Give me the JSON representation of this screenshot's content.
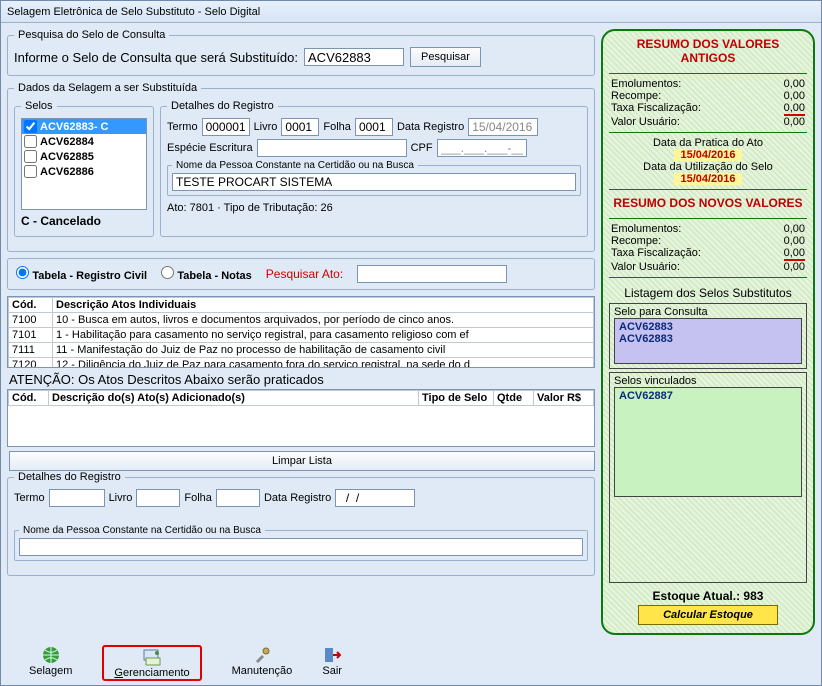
{
  "window": {
    "title": "Selagem Eletrônica de Selo Substituto - Selo Digital"
  },
  "pesquisa": {
    "legend": "Pesquisa do Selo de Consulta",
    "label": "Informe o Selo de Consulta que será Substituído:",
    "value": "ACV62883",
    "btn": "Pesquisar"
  },
  "dados": {
    "legend": "Dados da Selagem a ser Substituída",
    "selos_legend": "Selos",
    "selos": [
      {
        "label": "ACV62883- C",
        "checked": true,
        "selected": true
      },
      {
        "label": "ACV62884",
        "checked": false,
        "selected": false
      },
      {
        "label": "ACV62885",
        "checked": false,
        "selected": false
      },
      {
        "label": "ACV62886",
        "checked": false,
        "selected": false
      }
    ],
    "cancel_note": "C - Cancelado",
    "detalhes_legend": "Detalhes do Registro",
    "termo_lbl": "Termo",
    "termo": "000001",
    "livro_lbl": "Livro",
    "livro": "0001",
    "folha_lbl": "Folha",
    "folha": "0001",
    "dreg_lbl": "Data Registro",
    "dreg": "15/04/2016",
    "especie_lbl": "Espécie Escritura",
    "especie": "",
    "cpf_lbl": "CPF",
    "cpf_mask": "___.___.___-__",
    "nome_legend": "Nome da Pessoa Constante na Certidão ou na Busca",
    "nome": "TESTE PROCART SISTEMA",
    "ato_info": "Ato: 7801  ·  Tipo de Tributação: 26"
  },
  "tabela": {
    "radio_civil": "Tabela - Registro Civil",
    "radio_notas": "Tabela - Notas",
    "pesq_label": "Pesquisar Ato:",
    "cols": {
      "cod": "Cód.",
      "desc": "Descrição Atos Individuais"
    },
    "rows": [
      {
        "cod": "7100",
        "desc": "10 - Busca em autos, livros e documentos arquivados, por período de cinco anos."
      },
      {
        "cod": "7101",
        "desc": "1 - Habilitação para casamento no serviço registral, para casamento religioso com ef"
      },
      {
        "cod": "7111",
        "desc": "11 - Manifestação do Juiz de Paz no processo de habilitação de casamento civil"
      },
      {
        "cod": "7120",
        "desc": "12 - Diligência do Juiz de Paz para casamento fora do serviço registral, na sede do d"
      }
    ]
  },
  "atencao": {
    "title": "ATENÇÃO: Os Atos Descritos Abaixo serão praticados",
    "cols": {
      "cod": "Cód.",
      "desc": "Descrição do(s) Ato(s) Adicionado(s)",
      "tipo": "Tipo de Selo",
      "qtde": "Qtde",
      "valor": "Valor R$"
    },
    "limpar": "Limpar Lista"
  },
  "detreg": {
    "legend": "Detalhes do Registro",
    "termo": "Termo",
    "livro": "Livro",
    "folha": "Folha",
    "dreg": "Data Registro",
    "dreg_val": "  /  /",
    "nome_legend": "Nome da Pessoa Constante na Certidão ou na Busca"
  },
  "right": {
    "antigos_title": "RESUMO DOS VALORES ANTIGOS",
    "emol_lbl": "Emolumentos:",
    "emol": "0,00",
    "recompe_lbl": "Recompe:",
    "recompe": "0,00",
    "taxa_lbl": "Taxa Fiscalização:",
    "taxa": "0,00",
    "valu_lbl": "Valor Usuário:",
    "valu": "0,00",
    "data_pratica_lbl": "Data da Pratica do Ato",
    "data_pratica": "15/04/2016",
    "data_util_lbl": "Data da Utilização do Selo",
    "data_util": "15/04/2016",
    "novos_title": "RESUMO DOS NOVOS VALORES",
    "n_emol_lbl": "Emolumentos:",
    "n_emol": "0,00",
    "n_recompe_lbl": "Recompe:",
    "n_recompe": "0,00",
    "n_taxa_lbl": "Taxa Fiscalização:",
    "n_taxa": "0,00",
    "n_valu_lbl": "Valor Usuário:",
    "n_valu": "0,00",
    "listagem": "Listagem dos Selos Substitutos",
    "consulta_lbl": "Selo para Consulta",
    "consulta": [
      "ACV62883",
      "ACV62883"
    ],
    "vinc_lbl": "Selos vinculados",
    "vinc": [
      "ACV62887"
    ],
    "estoque_lbl": "Estoque Atual.: 983",
    "calc_btn": "Calcular Estoque"
  },
  "toolbar": {
    "selagem": "Selagem",
    "gerenciamento": "Gerenciamento",
    "manutencao": "Manutenção",
    "sair": "Sair"
  }
}
